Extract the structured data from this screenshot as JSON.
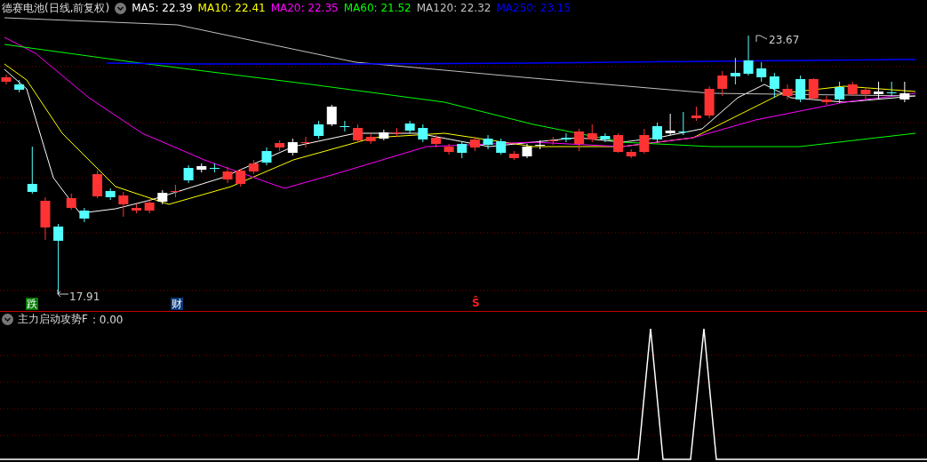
{
  "chart_header": {
    "title": "德赛电池(日线,前复权)",
    "moving_averages": [
      {
        "label": "MA5: 22.39",
        "color": "#ffffff"
      },
      {
        "label": "MA10: 22.41",
        "color": "#ffff00"
      },
      {
        "label": "MA20: 22.35",
        "color": "#ff00ff"
      },
      {
        "label": "MA60: 21.52",
        "color": "#00ff00"
      },
      {
        "label": "MA120: 22.32",
        "color": "#c0c0c0"
      },
      {
        "label": "MA250: 23.15",
        "color": "#0000ff"
      }
    ]
  },
  "price_labels": {
    "high": "23.67",
    "low": "17.91"
  },
  "markers": [
    {
      "kind": "badge",
      "label": "跌",
      "color": "#007a00"
    },
    {
      "kind": "badge",
      "label": "财",
      "color": "#0a3a7a"
    },
    {
      "kind": "signal",
      "label": "Ŝ",
      "color": "#ff2020"
    }
  ],
  "indicator": {
    "title": "主力启动攻势F",
    "value": ": 0.00"
  }
}
